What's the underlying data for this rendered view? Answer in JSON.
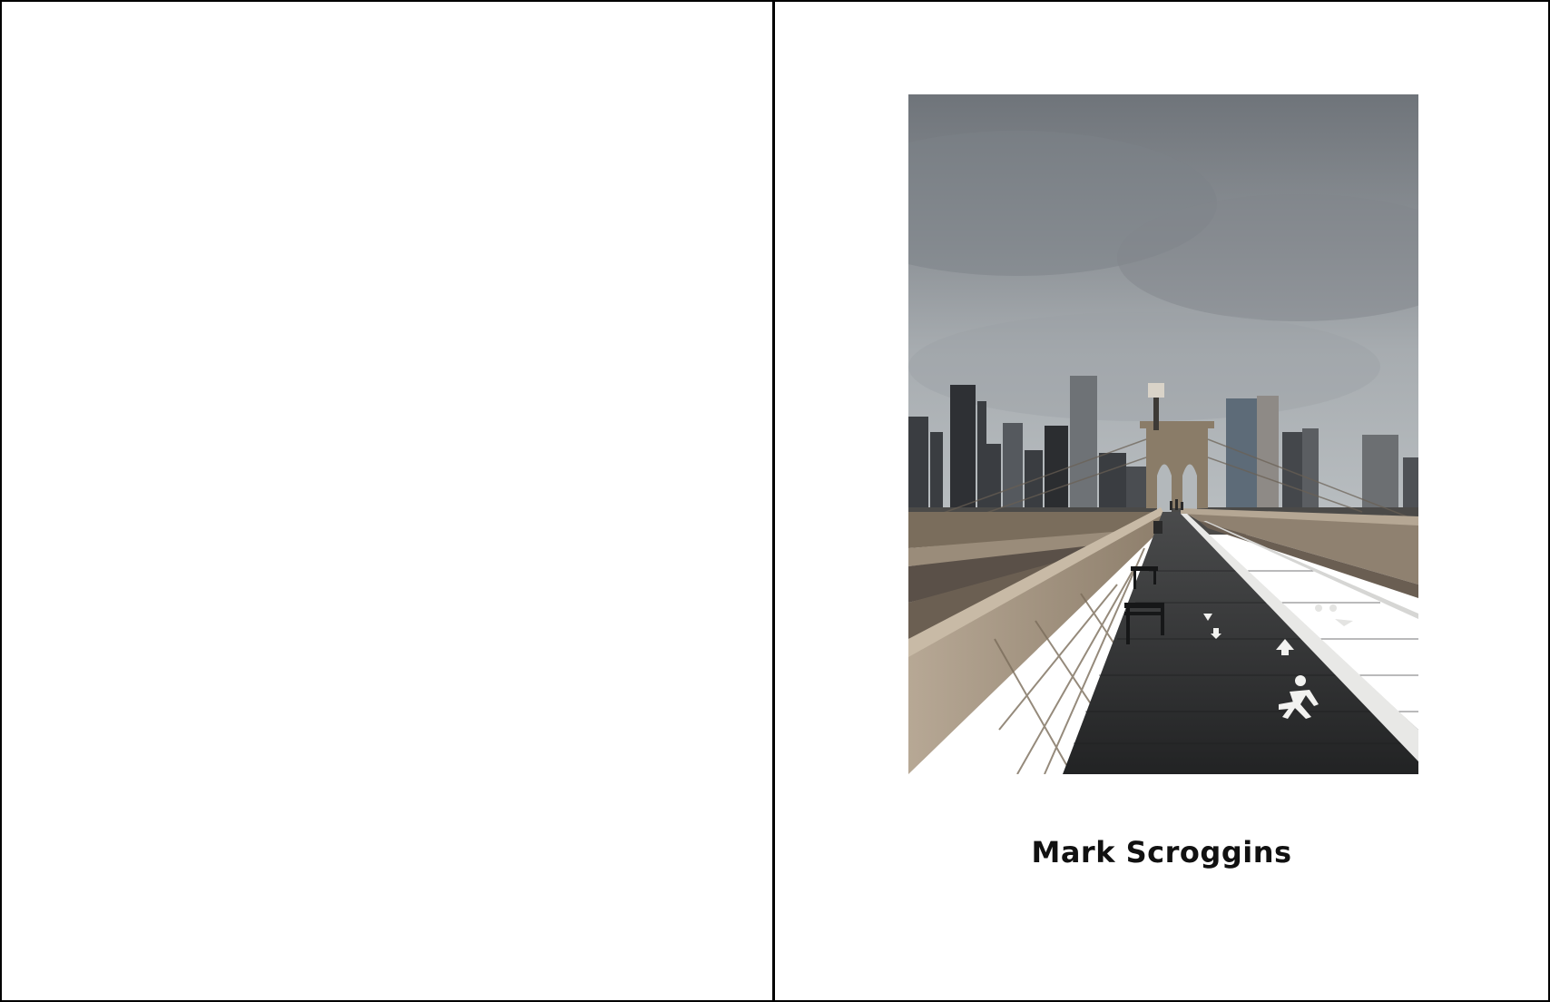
{
  "pages": {
    "left": {},
    "right": {
      "author": "Mark Scroggins"
    }
  },
  "photo": {
    "subject": "bridge-walkway-skyline"
  },
  "colors": {
    "border": "#000000",
    "text": "#111111",
    "sky": "#8a9096",
    "deck": "#2e2f30",
    "railing": "#a99a86"
  }
}
